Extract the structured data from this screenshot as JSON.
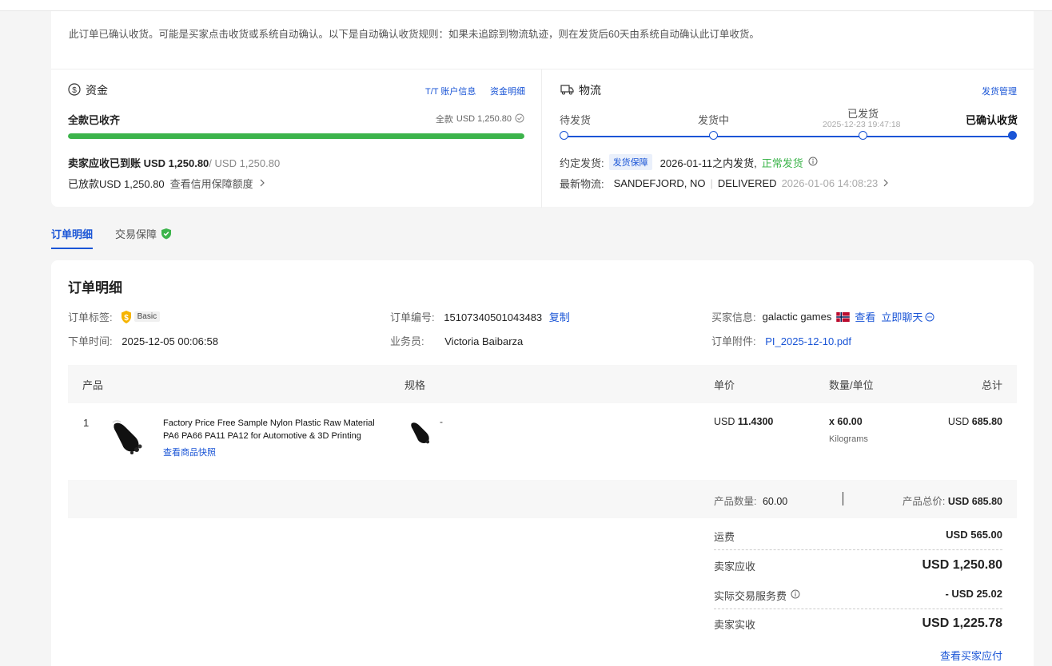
{
  "notice": {
    "text": "此订单已确认收货。可能是买家点击收货或系统自动确认。以下是自动确认收货规则：如果未追踪到物流轨迹，则在发货后60天由系统自动确认此订单收货。"
  },
  "funds": {
    "title": "资金",
    "links": [
      "T/T 账户信息",
      "资金明细"
    ],
    "status": "全款已收齐",
    "full_label": "全款",
    "full_amount": "USD 1,250.80",
    "progress_percent": 100,
    "seller_received_label": "卖家应收已到账 USD 1,250.80",
    "seller_received_total": "/ USD 1,250.80",
    "released": "已放款USD 1,250.80",
    "credit_link": "查看信用保障额度"
  },
  "logistics": {
    "title": "物流",
    "manage_link": "发货管理",
    "steps": [
      {
        "label": "待发货",
        "sub": ""
      },
      {
        "label": "发货中",
        "sub": ""
      },
      {
        "label": "已发货",
        "sub": "2025-12-23 19:47:18"
      },
      {
        "label": "已确认收货",
        "sub": ""
      }
    ],
    "ship_label": "约定发货:",
    "ship_tag": "发货保障",
    "ship_text": "2026-01-11之内发货,",
    "ship_status": "正常发货",
    "latest_label": "最新物流:",
    "latest_location": "SANDEFJORD, NO",
    "latest_status": "DELIVERED",
    "latest_time": "2026-01-06 14:08:23"
  },
  "tabs": [
    {
      "label": "订单明细",
      "active": true
    },
    {
      "label": "交易保障",
      "active": false
    }
  ],
  "order": {
    "title": "订单明细",
    "tag_label": "订单标签:",
    "tag_badge": "Basic",
    "time_label": "下单时间:",
    "time_value": "2025-12-05 00:06:58",
    "no_label": "订单编号:",
    "no_value": "15107340501043483",
    "copy": "复制",
    "sales_label": "业务员:",
    "sales_value": "Victoria Baibarza",
    "buyer_label": "买家信息:",
    "buyer_value": "galactic games",
    "buyer_view": "查看",
    "buyer_chat": "立即聊天",
    "attach_label": "订单附件:",
    "attach_value": "PI_2025-12-10.pdf"
  },
  "table": {
    "headers": [
      "产品",
      "规格",
      "单价",
      "数量/单位",
      "总计"
    ],
    "rows": [
      {
        "index": "1",
        "name_line1": "Factory Price Free Sample Nylon Plastic Raw Material",
        "name_line2": "PA6 PA66 PA11 PA12 for Automotive & 3D Printing",
        "snapshot_link": "查看商品快照",
        "spec": "-",
        "price_prefix": "USD ",
        "price_value": "11.4300",
        "qty": "x 60.00",
        "unit": "Kilograms",
        "total_prefix": "USD ",
        "total_value": "685.80"
      }
    ]
  },
  "summary": {
    "qty_label": "产品数量:",
    "qty_value": "60.00",
    "total_label": "产品总价:",
    "total_value": "USD 685.80"
  },
  "fees": {
    "shipping_label": "运费",
    "shipping_value": "USD 565.00",
    "receivable_label": "卖家应收",
    "receivable_value": "USD 1,250.80",
    "service_label": "实际交易服务费",
    "service_value": "- USD 25.02",
    "actual_label": "卖家实收",
    "actual_value": "USD 1,225.78",
    "buyer_payable_link": "查看买家应付"
  },
  "colors": {
    "accent": "#1a55d6",
    "success": "#3cb44b"
  }
}
